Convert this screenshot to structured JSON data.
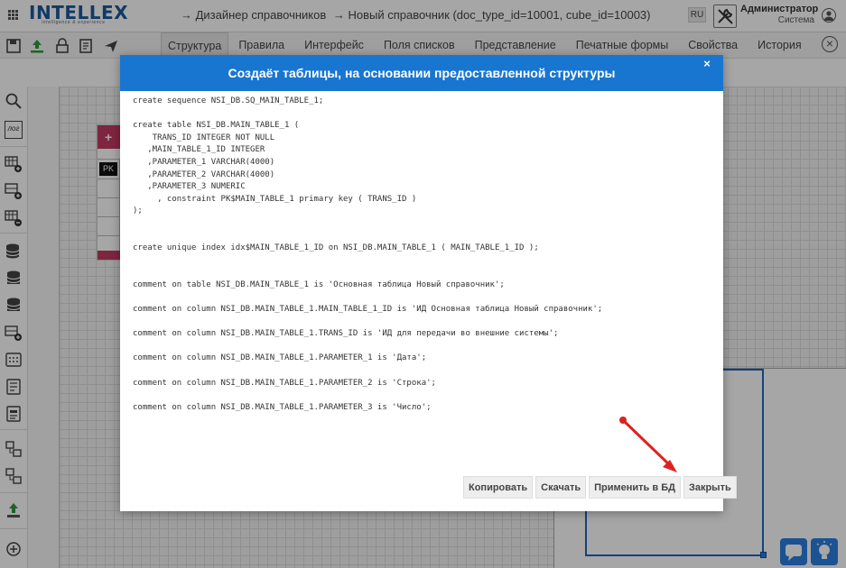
{
  "header": {
    "logo_text": "INTELLEX",
    "logo_tagline": "intelligence & experience",
    "breadcrumbs": [
      "→ Дизайнер справочников",
      "→ Новый справочник (doc_type_id=10001, cube_id=10003)"
    ],
    "language": "RU",
    "user_name": "Администратор",
    "user_role": "Система"
  },
  "tabs": [
    {
      "label": "Структура",
      "active": true
    },
    {
      "label": "Правила",
      "active": false
    },
    {
      "label": "Интерфейс",
      "active": false
    },
    {
      "label": "Поля списков",
      "active": false
    },
    {
      "label": "Представление",
      "active": false
    },
    {
      "label": "Печатные формы",
      "active": false
    },
    {
      "label": "Свойства",
      "active": false
    },
    {
      "label": "История",
      "active": false
    }
  ],
  "left_panel": {
    "log_label": "лог"
  },
  "canvas": {
    "table_add_glyph": "+",
    "pk_label": "PK"
  },
  "modal": {
    "title": "Создаёт таблицы, на основании предоставленной структуры",
    "close_glyph": "×",
    "code_lines": [
      "create sequence NSI_DB.SQ_MAIN_TABLE_1;",
      "",
      "create table NSI_DB.MAIN_TABLE_1 (",
      "    TRANS_ID INTEGER NOT NULL",
      "   ,MAIN_TABLE_1_ID INTEGER",
      "   ,PARAMETER_1 VARCHAR(4000)",
      "   ,PARAMETER_2 VARCHAR(4000)",
      "   ,PARAMETER_3 NUMERIC",
      "     , constraint PK$MAIN_TABLE_1 primary key ( TRANS_ID )",
      ");",
      "",
      "",
      "create unique index idx$MAIN_TABLE_1_ID on NSI_DB.MAIN_TABLE_1 ( MAIN_TABLE_1_ID );",
      "",
      "",
      "comment on table NSI_DB.MAIN_TABLE_1 is 'Основная таблица Новый справочник';",
      "",
      "comment on column NSI_DB.MAIN_TABLE_1.MAIN_TABLE_1_ID is 'ИД Основная таблица Новый справочник';",
      "",
      "comment on column NSI_DB.MAIN_TABLE_1.TRANS_ID is 'ИД для передачи во внешние системы';",
      "",
      "comment on column NSI_DB.MAIN_TABLE_1.PARAMETER_1 is 'Дата';",
      "",
      "comment on column NSI_DB.MAIN_TABLE_1.PARAMETER_2 is 'Строка';",
      "",
      "comment on column NSI_DB.MAIN_TABLE_1.PARAMETER_3 is 'Число';"
    ],
    "buttons": {
      "copy": "Копировать",
      "download": "Скачать",
      "apply_db": "Применить в БД",
      "close": "Закрыть"
    }
  },
  "colors": {
    "modal_header": "#1876d1",
    "table_header": "#c23b61",
    "annotation_arrow": "#e02020",
    "brand": "#1a5a9c"
  }
}
